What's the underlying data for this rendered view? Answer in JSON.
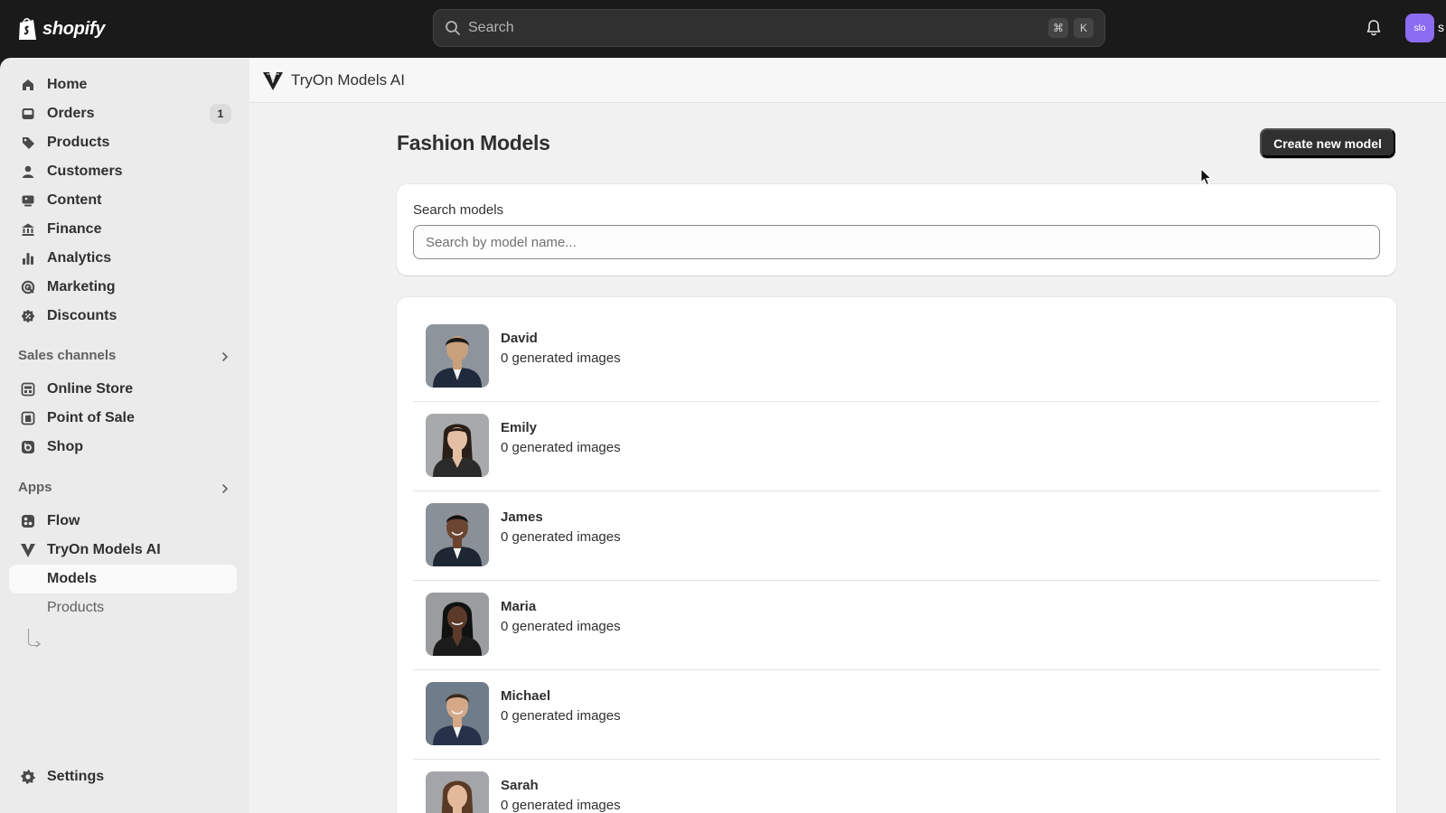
{
  "topbar": {
    "brand": "shopify",
    "search_placeholder": "Search",
    "shortcut_keys": [
      "⌘",
      "K"
    ],
    "avatar_initials": "slo",
    "avatar_trunc": "s"
  },
  "sidebar": {
    "items": [
      {
        "label": "Home",
        "icon": "home-icon"
      },
      {
        "label": "Orders",
        "icon": "orders-icon",
        "badge": "1"
      },
      {
        "label": "Products",
        "icon": "tag-icon"
      },
      {
        "label": "Customers",
        "icon": "person-icon"
      },
      {
        "label": "Content",
        "icon": "content-icon"
      },
      {
        "label": "Finance",
        "icon": "bank-icon"
      },
      {
        "label": "Analytics",
        "icon": "bar-chart-icon"
      },
      {
        "label": "Marketing",
        "icon": "target-icon"
      },
      {
        "label": "Discounts",
        "icon": "discount-icon"
      }
    ],
    "sales_channels_heading": "Sales channels",
    "sales_channels": [
      {
        "label": "Online Store",
        "icon": "store-icon"
      },
      {
        "label": "Point of Sale",
        "icon": "pos-icon"
      },
      {
        "label": "Shop",
        "icon": "shop-icon"
      }
    ],
    "apps_heading": "Apps",
    "apps": [
      {
        "label": "Flow",
        "icon": "flow-icon"
      },
      {
        "label": "TryOn Models AI",
        "icon": "tryon-logo-icon"
      }
    ],
    "app_subitems": [
      {
        "label": "Models",
        "active": true
      },
      {
        "label": "Products",
        "active": false
      }
    ],
    "settings": "Settings"
  },
  "app": {
    "title": "TryOn Models AI"
  },
  "page": {
    "title": "Fashion Models",
    "create_button": "Create new model",
    "search_label": "Search models",
    "search_placeholder": "Search by model name..."
  },
  "models": [
    {
      "name": "David",
      "count": "0 generated images",
      "skin": "#c9a07c",
      "hair": "#1e1a17",
      "suit": "#1f2a3d",
      "bg": "#8d949c"
    },
    {
      "name": "Emily",
      "count": "0 generated images",
      "skin": "#e3bfa3",
      "hair": "#2a1e18",
      "suit": "#2b2b2b",
      "bg": "#a7a9ab"
    },
    {
      "name": "James",
      "count": "0 generated images",
      "skin": "#6b4530",
      "hair": "#111111",
      "suit": "#1e2633",
      "bg": "#8a9097"
    },
    {
      "name": "Maria",
      "count": "0 generated images",
      "skin": "#5b3a2a",
      "hair": "#111111",
      "suit": "#1b1b1b",
      "bg": "#9a9c9e"
    },
    {
      "name": "Michael",
      "count": "0 generated images",
      "skin": "#d5a887",
      "hair": "#3a2a1e",
      "suit": "#27324a",
      "bg": "#6f7c8a"
    },
    {
      "name": "Sarah",
      "count": "0 generated images",
      "skin": "#e2b99a",
      "hair": "#5a3a24",
      "suit": "#2b2b2b",
      "bg": "#a3a5a8"
    }
  ],
  "colors": {
    "topbar": "#1a1a1a",
    "sidebar": "#ebebeb",
    "main": "#f1f1f1",
    "primary_button": "#303030",
    "avatar": "#8a6cf3"
  }
}
